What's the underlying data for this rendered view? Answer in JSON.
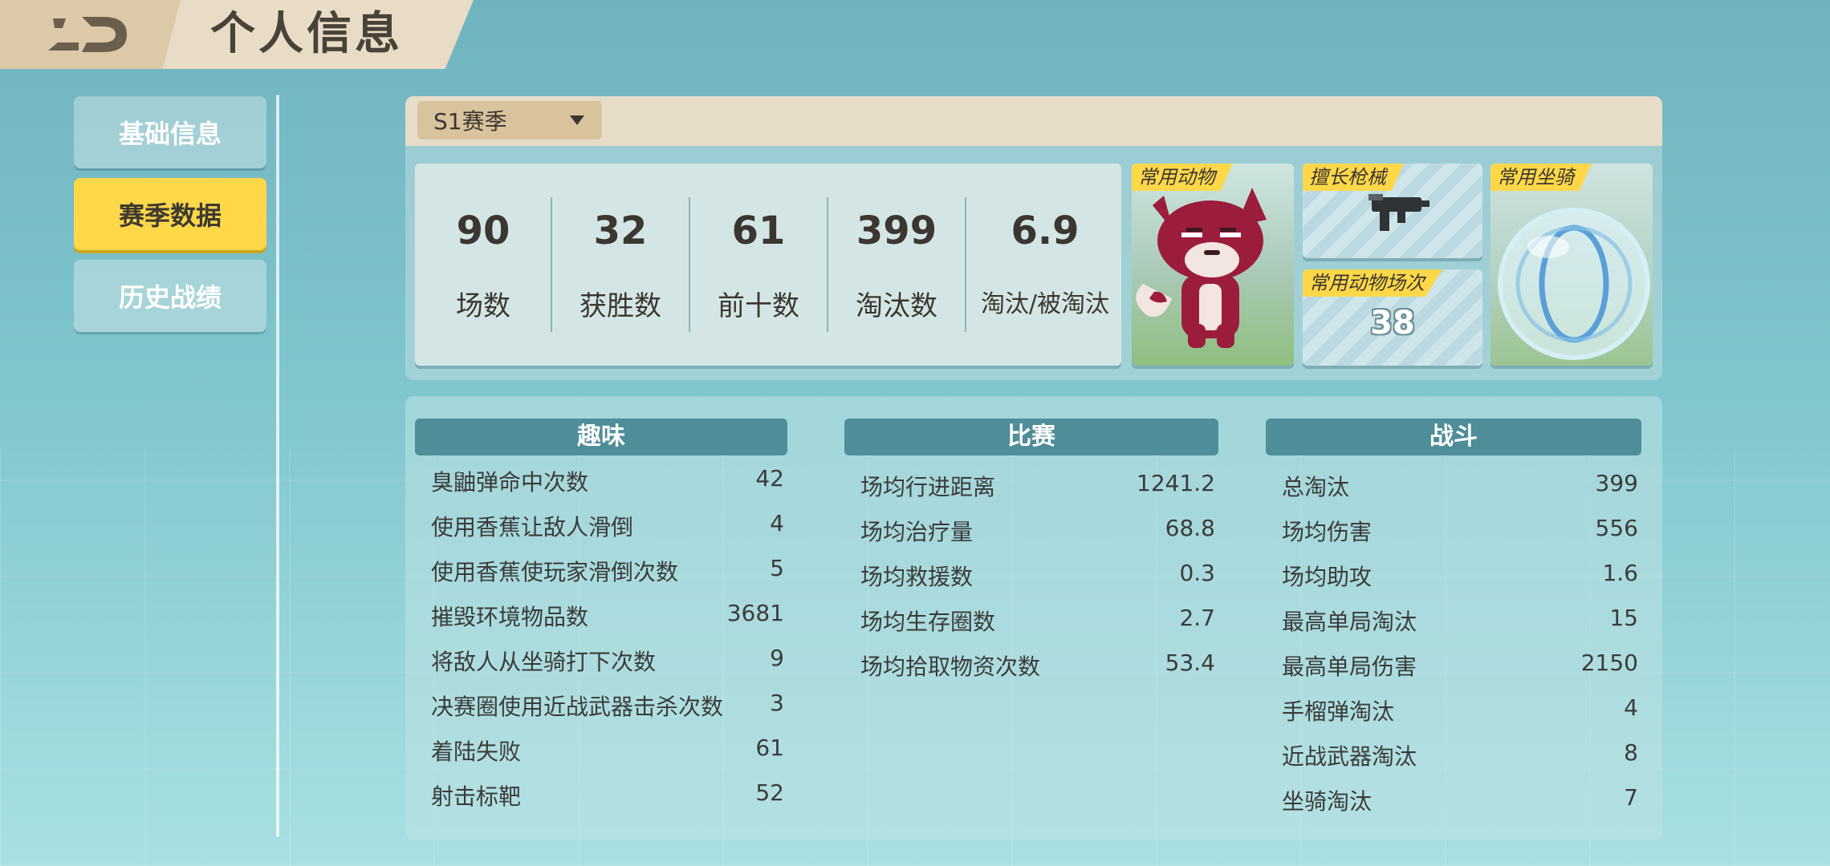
{
  "header": {
    "title": "个人信息",
    "back_icon": "back-arrow-icon"
  },
  "nav": {
    "items": [
      {
        "label": "基础信息",
        "active": false
      },
      {
        "label": "赛季数据",
        "active": true
      },
      {
        "label": "历史战绩",
        "active": false
      }
    ]
  },
  "season": {
    "selected": "S1赛季"
  },
  "summary": [
    {
      "value": "90",
      "label": "场数"
    },
    {
      "value": "32",
      "label": "获胜数"
    },
    {
      "value": "61",
      "label": "前十数"
    },
    {
      "value": "399",
      "label": "淘汰数"
    },
    {
      "value": "6.9",
      "label": "淘汰/被淘汰"
    }
  ],
  "cards": {
    "animal": {
      "tag": "常用动物"
    },
    "weapon": {
      "tag": "擅长枪械"
    },
    "count": {
      "tag": "常用动物场次",
      "value": "38"
    },
    "mount": {
      "tag": "常用坐骑"
    }
  },
  "columns": [
    {
      "title": "趣味",
      "rows": [
        {
          "k": "臭鼬弹命中次数",
          "v": "42"
        },
        {
          "k": "使用香蕉让敌人滑倒",
          "v": "4"
        },
        {
          "k": "使用香蕉使玩家滑倒次数",
          "v": "5"
        },
        {
          "k": "摧毁环境物品数",
          "v": "3681"
        },
        {
          "k": "将敌人从坐骑打下次数",
          "v": "9"
        },
        {
          "k": "决赛圈使用近战武器击杀次数",
          "v": "3"
        },
        {
          "k": "着陆失败",
          "v": "61"
        },
        {
          "k": "射击标靶",
          "v": "52"
        }
      ]
    },
    {
      "title": "比赛",
      "rows": [
        {
          "k": "场均行进距离",
          "v": "1241.2"
        },
        {
          "k": "场均治疗量",
          "v": "68.8"
        },
        {
          "k": "场均救援数",
          "v": "0.3"
        },
        {
          "k": "场均生存圈数",
          "v": "2.7"
        },
        {
          "k": "场均拾取物资次数",
          "v": "53.4"
        }
      ]
    },
    {
      "title": "战斗",
      "rows": [
        {
          "k": "总淘汰",
          "v": "399"
        },
        {
          "k": "场均伤害",
          "v": "556"
        },
        {
          "k": "场均助攻",
          "v": "1.6"
        },
        {
          "k": "最高单局淘汰",
          "v": "15"
        },
        {
          "k": "最高单局伤害",
          "v": "2150"
        },
        {
          "k": "手榴弹淘汰",
          "v": "4"
        },
        {
          "k": "近战武器淘汰",
          "v": "8"
        },
        {
          "k": "坐骑淘汰",
          "v": "7"
        }
      ]
    }
  ]
}
